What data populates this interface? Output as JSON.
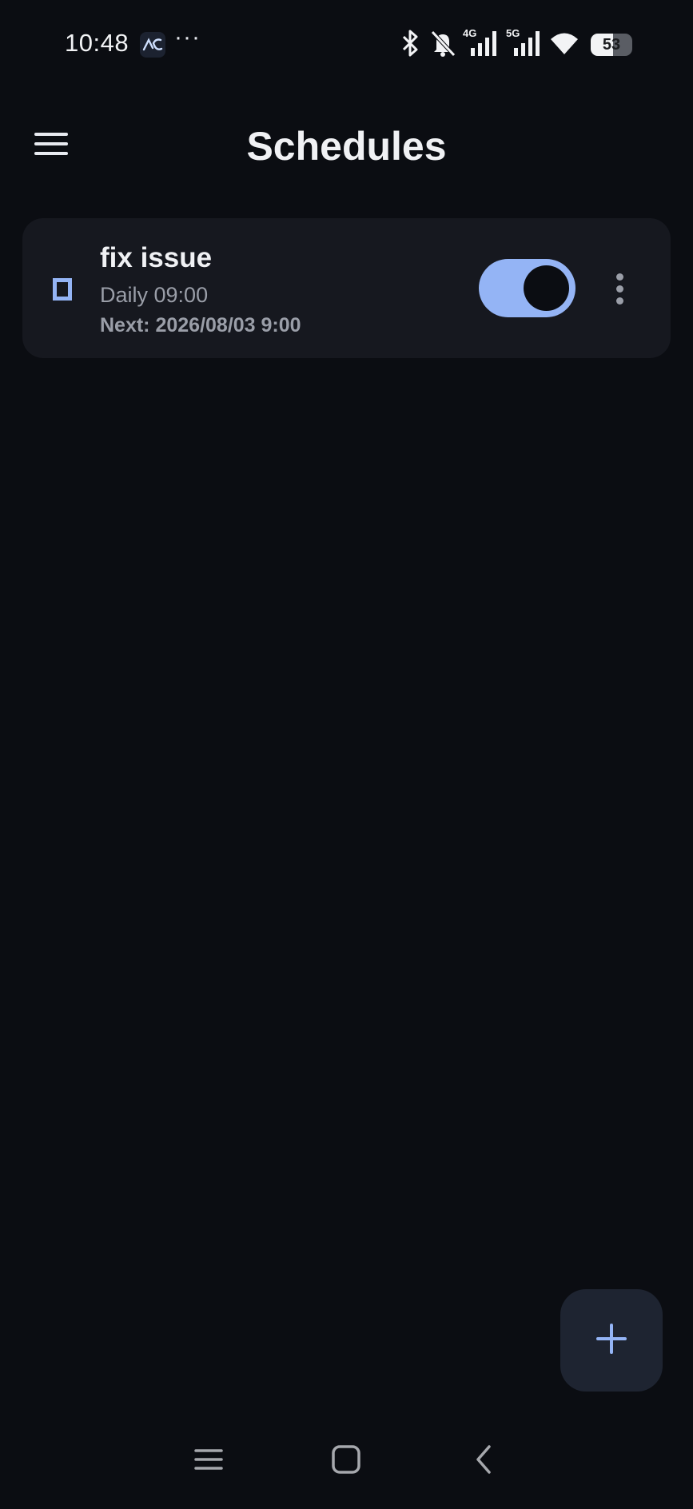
{
  "status_bar": {
    "time": "10:48",
    "app_icon": "pulse-icon",
    "overflow": "···",
    "network_4g": "4G",
    "network_5g": "5G",
    "battery_level": "53",
    "icons": [
      "bluetooth-icon",
      "bell-off-icon",
      "signal-4g-icon",
      "signal-5g-icon",
      "wifi-icon",
      "battery-icon"
    ]
  },
  "app_bar": {
    "title": "Schedules",
    "menu_icon": "hamburger-menu-icon"
  },
  "schedules": [
    {
      "title": "fix issue",
      "frequency": "Daily 09:00",
      "next_run": "Next: 2026/08/03 9:00",
      "enabled": true,
      "icon": "task-icon"
    }
  ],
  "fab": {
    "icon": "plus-icon"
  },
  "nav_bar": {
    "icons": [
      "recents-icon",
      "home-icon",
      "back-icon"
    ]
  },
  "colors": {
    "background": "#0b0d12",
    "card": "#16181f",
    "accent": "#94b4f5",
    "fab": "#1e2431",
    "secondary_text": "#9a9ea8"
  }
}
